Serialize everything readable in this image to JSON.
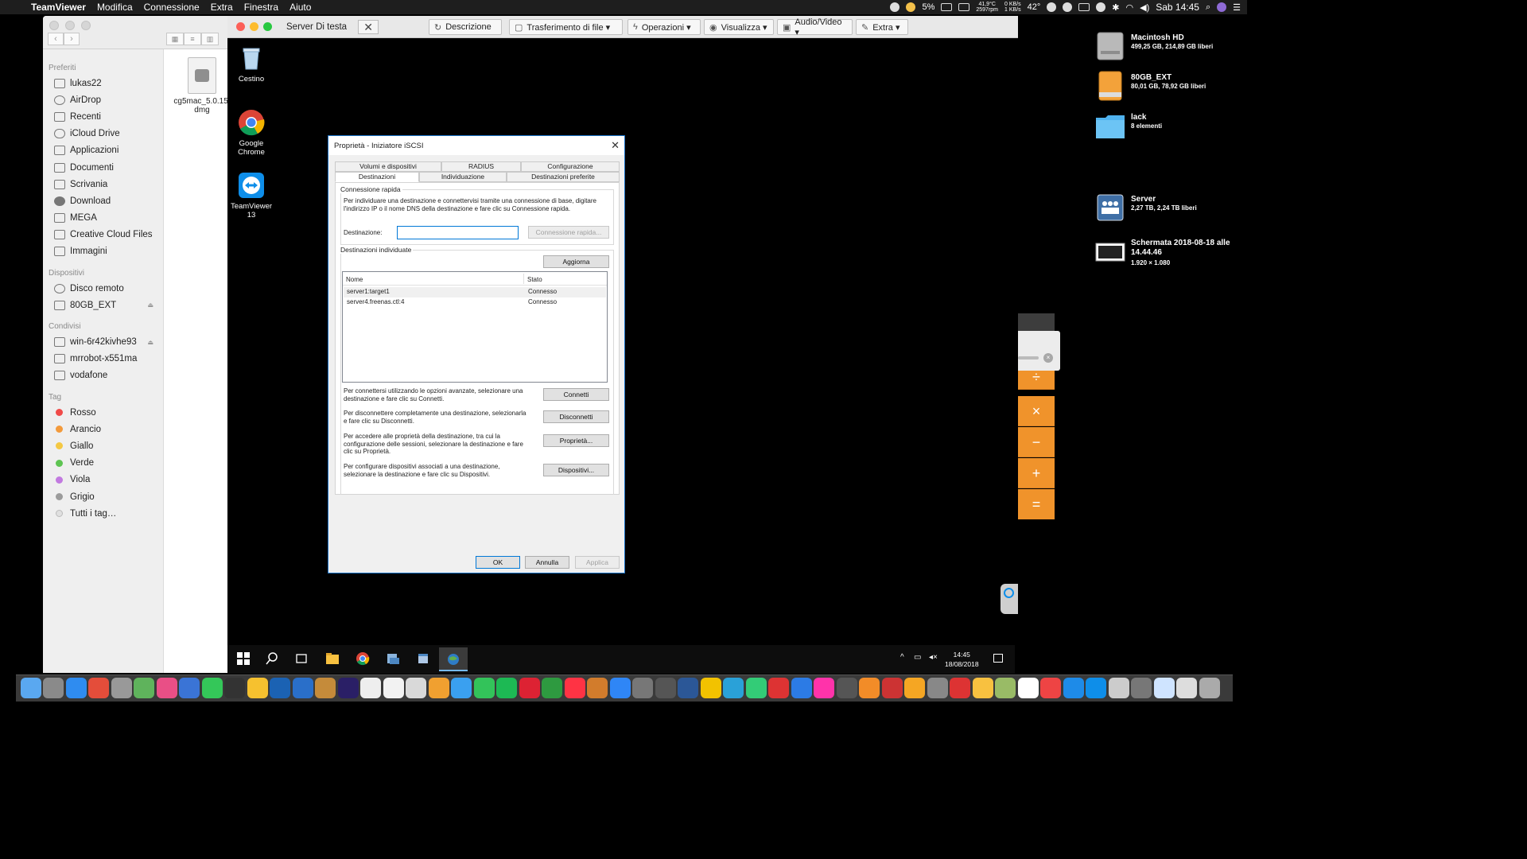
{
  "menubar": {
    "app": "TeamViewer",
    "menus": [
      "Modifica",
      "Connessione",
      "Extra",
      "Finestra",
      "Aiuto"
    ],
    "battery": "5%",
    "temp_cpu": "41,9°C",
    "fan_rpm": "2597rpm",
    "net_up": "0 KB/s",
    "net_down": "1 KB/s",
    "temp2": "42°",
    "clock": "Sab 14:45"
  },
  "finder": {
    "sections": [
      {
        "header": "Preferiti",
        "items": [
          "lukas22",
          "AirDrop",
          "Recenti",
          "iCloud Drive",
          "Applicazioni",
          "Documenti",
          "Scrivania",
          "Download",
          "MEGA",
          "Creative Cloud Files",
          "Immagini"
        ]
      },
      {
        "header": "Dispositivi",
        "items": [
          "Disco remoto",
          "80GB_EXT"
        ]
      },
      {
        "header": "Condivisi",
        "items": [
          "win-6r42kivhe93",
          "mrrobot-x551ma",
          "vodafone"
        ]
      }
    ],
    "tags_header": "Tag",
    "tags": [
      {
        "name": "Rosso",
        "color": "#f04a48"
      },
      {
        "name": "Arancio",
        "color": "#f39a3b"
      },
      {
        "name": "Giallo",
        "color": "#f4c843"
      },
      {
        "name": "Verde",
        "color": "#5ec452"
      },
      {
        "name": "Viola",
        "color": "#c27ae0"
      },
      {
        "name": "Grigio",
        "color": "#9b9b9b"
      },
      {
        "name": "Tutti i tag…",
        "color": "#e0e0e0"
      }
    ],
    "file": {
      "name_line1": "cg5mac_5.0.15.",
      "name_line2": "dmg"
    }
  },
  "teamviewer": {
    "title": "Server Di testa",
    "buttons": [
      "Descrizione",
      "Trasferimento di file ▾",
      "Operazioni ▾",
      "Visualizza ▾",
      "Audio/Video ▾",
      "Extra ▾"
    ],
    "desktop_icons": [
      {
        "label": "Cestino"
      },
      {
        "label": "Google Chrome"
      },
      {
        "label": "TeamViewer 13"
      }
    ],
    "taskbar_time": "14:45",
    "taskbar_date": "18/08/2018"
  },
  "dialog": {
    "title": "Proprietà - Iniziatore iSCSI",
    "tabs_row1": [
      "Volumi e dispositivi",
      "RADIUS",
      "Configurazione"
    ],
    "tabs_row2": [
      "Destinazioni",
      "Individuazione",
      "Destinazioni preferite"
    ],
    "quick_connect": {
      "label": "Connessione rapida",
      "description": "Per individuare una destinazione e connettervisi tramite una connessione di base, digitare l'indirizzo IP o il nome DNS della destinazione e fare clic su Connessione rapida.",
      "target_label": "Destinazione:",
      "target_value": "",
      "button": "Connessione rapida..."
    },
    "discovered": {
      "label": "Destinazioni individuate",
      "refresh": "Aggiorna",
      "columns": [
        "Nome",
        "Stato"
      ],
      "rows": [
        {
          "name": "server1:target1",
          "status": "Connesso"
        },
        {
          "name": "server4.freenas.ctl:4",
          "status": "Connesso"
        }
      ]
    },
    "actions": [
      {
        "text": "Per connettersi utilizzando le opzioni avanzate, selezionare una destinazione e fare clic su Connetti.",
        "button": "Connetti"
      },
      {
        "text": "Per disconnettere completamente una destinazione, selezionarla e fare clic su Disconnetti.",
        "button": "Disconnetti"
      },
      {
        "text": "Per accedere alle proprietà della destinazione, tra cui la configurazione delle sessioni, selezionare la destinazione e fare clic su Proprietà.",
        "button": "Proprietà..."
      },
      {
        "text": "Per configurare dispositivi associati a una destinazione, selezionare la destinazione e fare clic su Dispositivi.",
        "button": "Dispositivi..."
      }
    ],
    "footer": {
      "ok": "OK",
      "cancel": "Annulla",
      "apply": "Applica"
    }
  },
  "desktop_right": [
    {
      "name": "Macintosh HD",
      "sub": "499,25 GB, 214,89 GB liberi"
    },
    {
      "name": "80GB_EXT",
      "sub": "80,01 GB, 78,92 GB liberi"
    },
    {
      "name": "lack",
      "sub": "8 elementi"
    },
    {
      "name": "Server",
      "sub": "2,27 TB, 2,24 TB liberi"
    },
    {
      "name": "Schermata 2018-08-18 alle 14.44.46",
      "sub": "1.920 × 1.080"
    }
  ],
  "calc_keys": [
    "÷",
    "×",
    "−",
    "+",
    "="
  ]
}
